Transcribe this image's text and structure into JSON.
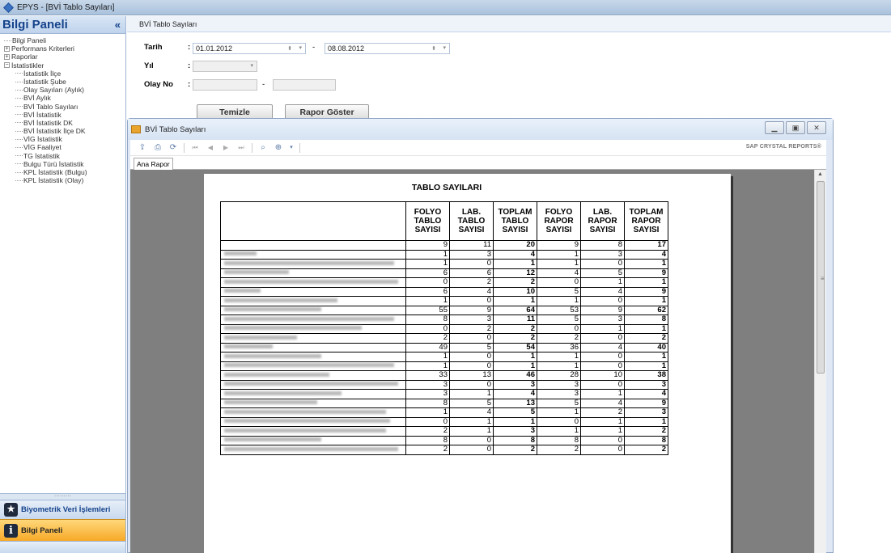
{
  "window": {
    "title": "EPYS - [BVİ Tablo Sayıları]"
  },
  "left_panel": {
    "title": "Bilgi Paneli",
    "collapse_glyph": "«",
    "tree": [
      {
        "label": "Bilgi Paneli",
        "level": 1,
        "expander": ""
      },
      {
        "label": "Performans Kriterleri",
        "level": 1,
        "expander": "+"
      },
      {
        "label": "Raporlar",
        "level": 1,
        "expander": "+"
      },
      {
        "label": "İstatistikler",
        "level": 1,
        "expander": "−"
      },
      {
        "label": "İstatistik İlçe",
        "level": 2
      },
      {
        "label": "İstatistik Şube",
        "level": 2
      },
      {
        "label": "Olay Sayıları (Aylık)",
        "level": 2
      },
      {
        "label": "BVİ Aylık",
        "level": 2
      },
      {
        "label": "BVİ Tablo Sayıları",
        "level": 2
      },
      {
        "label": "BVİ İstatistik",
        "level": 2
      },
      {
        "label": "BVİ İstatistik DK",
        "level": 2
      },
      {
        "label": "BVİ İstatistik İlçe DK",
        "level": 2
      },
      {
        "label": "VİG İstatistik",
        "level": 2
      },
      {
        "label": "VİG Faaliyet",
        "level": 2
      },
      {
        "label": "TG İstatistik",
        "level": 2
      },
      {
        "label": "Bulgu Türü İstatistik",
        "level": 2
      },
      {
        "label": "KPL İstatistik (Bulgu)",
        "level": 2
      },
      {
        "label": "KPL İstatistik (Olay)",
        "level": 2
      }
    ],
    "grip": "·········",
    "nav": [
      {
        "label": "Biyometrik Veri İşlemleri",
        "icon": "star-icon"
      },
      {
        "label": "Bilgi Paneli",
        "icon": "info-icon"
      }
    ]
  },
  "filter_form": {
    "section_title": "BVİ Tablo Sayıları",
    "tarih_label": "Tarih",
    "tarih_start": "01.01.2012",
    "tarih_dash": "-",
    "tarih_end": "08.08.2012",
    "yil_label": "Yıl",
    "yil_value": "",
    "olayno_label": "Olay No",
    "olayno_dash": "-",
    "colon": ":",
    "clear_button": "Temizle",
    "report_button": "Rapor Göster"
  },
  "report_window": {
    "title": "BVİ Tablo Sayıları",
    "brand": "SAP CRYSTAL REPORTS®",
    "tab": "Ana Rapor",
    "report_title": "TABLO SAYILARI",
    "columns": [
      "",
      "FOLYO TABLO SAYISI",
      "LAB. TABLO SAYISI",
      "TOPLAM TABLO SAYISI",
      "FOLYO RAPOR SAYISI",
      "LAB. RAPOR SAYISI",
      "TOPLAM RAPOR SAYISI"
    ],
    "rows": [
      [
        9,
        11,
        20,
        9,
        8,
        17
      ],
      [
        1,
        3,
        4,
        1,
        3,
        4
      ],
      [
        1,
        0,
        1,
        1,
        0,
        1
      ],
      [
        6,
        6,
        12,
        4,
        5,
        9
      ],
      [
        0,
        2,
        2,
        0,
        1,
        1
      ],
      [
        6,
        4,
        10,
        5,
        4,
        9
      ],
      [
        1,
        0,
        1,
        1,
        0,
        1
      ],
      [
        55,
        9,
        64,
        53,
        9,
        62
      ],
      [
        8,
        3,
        11,
        5,
        3,
        8
      ],
      [
        0,
        2,
        2,
        0,
        1,
        1
      ],
      [
        2,
        0,
        2,
        2,
        0,
        2
      ],
      [
        49,
        5,
        54,
        36,
        4,
        40
      ],
      [
        1,
        0,
        1,
        1,
        0,
        1
      ],
      [
        1,
        0,
        1,
        1,
        0,
        1
      ],
      [
        33,
        13,
        46,
        28,
        10,
        38
      ],
      [
        3,
        0,
        3,
        3,
        0,
        3
      ],
      [
        3,
        1,
        4,
        3,
        1,
        4
      ],
      [
        8,
        5,
        13,
        5,
        4,
        9
      ],
      [
        1,
        4,
        5,
        1,
        2,
        3
      ],
      [
        0,
        1,
        1,
        0,
        1,
        1
      ],
      [
        2,
        1,
        3,
        1,
        1,
        2
      ],
      [
        8,
        0,
        8,
        8,
        0,
        8
      ],
      [
        2,
        0,
        2,
        2,
        0,
        2
      ]
    ]
  }
}
